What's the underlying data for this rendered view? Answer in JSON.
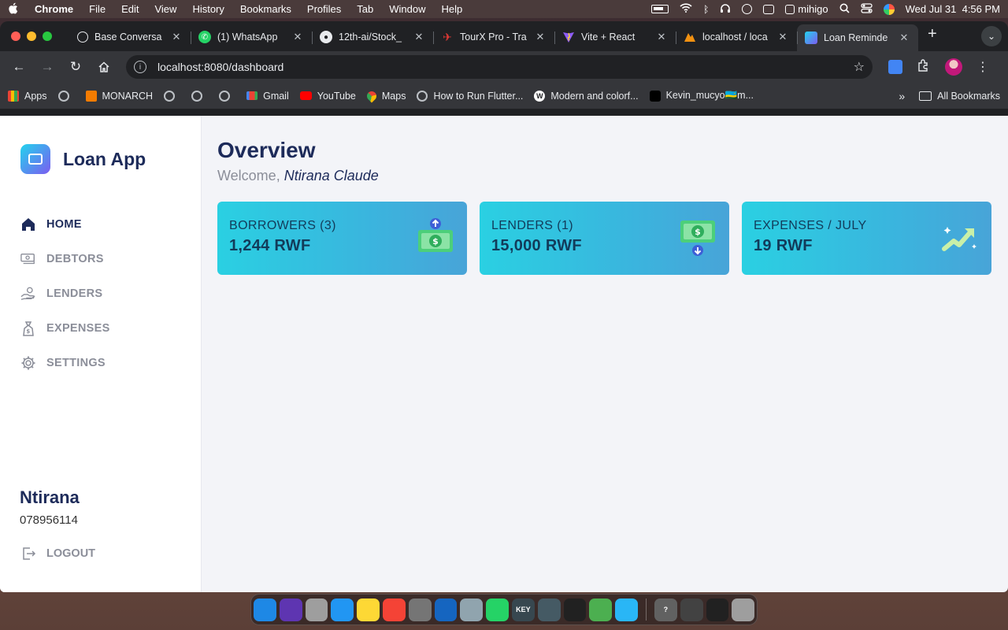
{
  "menubar": {
    "app": "Chrome",
    "items": [
      "File",
      "Edit",
      "View",
      "History",
      "Bookmarks",
      "Profiles",
      "Tab",
      "Window",
      "Help"
    ],
    "user": "mihigo",
    "datetime": "Wed Jul 31  4:56 PM"
  },
  "browser": {
    "tabs": [
      {
        "title": "Base Conversa",
        "favicon": "openai-icon",
        "color": "#202124"
      },
      {
        "title": "(1) WhatsApp",
        "favicon": "whatsapp-icon",
        "color": "#25d366"
      },
      {
        "title": "12th-ai/Stock_",
        "favicon": "github-icon",
        "color": "#202124"
      },
      {
        "title": "TourX Pro - Tra",
        "favicon": "tourx-icon",
        "color": "#e53935"
      },
      {
        "title": "Vite + React",
        "favicon": "vite-icon",
        "color": "#8e5cf7"
      },
      {
        "title": "localhost / loca",
        "favicon": "phpmyadmin-icon",
        "color": "#f29111"
      },
      {
        "title": "Loan Reminde",
        "favicon": "loan-app-icon",
        "color": "#22b3e0",
        "active": true
      }
    ],
    "new_tab_label": "+",
    "url": "localhost:8080/dashboard",
    "bookmarks": [
      {
        "label": "Apps",
        "icon": "apps-grid-icon"
      },
      {
        "label": "",
        "icon": "globe-icon"
      },
      {
        "label": "MONARCH",
        "icon": "monarch-icon"
      },
      {
        "label": "",
        "icon": "globe-icon"
      },
      {
        "label": "",
        "icon": "globe-icon"
      },
      {
        "label": "",
        "icon": "globe-icon"
      },
      {
        "label": "Gmail",
        "icon": "gmail-icon"
      },
      {
        "label": "YouTube",
        "icon": "youtube-icon"
      },
      {
        "label": "Maps",
        "icon": "maps-icon"
      },
      {
        "label": "How to Run Flutter...",
        "icon": "globe-icon"
      },
      {
        "label": "Modern and colorf...",
        "icon": "w-icon"
      },
      {
        "label": "Kevin_mucyo🇷🇼m...",
        "icon": "tiktok-icon"
      }
    ],
    "more_bookmarks": "»",
    "all_bookmarks": "All Bookmarks"
  },
  "app": {
    "brand": "Loan App",
    "nav": [
      {
        "label": "HOME",
        "icon": "home-icon",
        "active": true
      },
      {
        "label": "DEBTORS",
        "icon": "money-icon",
        "active": false
      },
      {
        "label": "LENDERS",
        "icon": "hand-money-icon",
        "active": false
      },
      {
        "label": "EXPENSES",
        "icon": "money-bag-icon",
        "active": false
      },
      {
        "label": "SETTINGS",
        "icon": "gear-icon",
        "active": false
      }
    ],
    "user": {
      "name": "Ntirana",
      "phone": "078956114"
    },
    "logout_label": "LOGOUT",
    "page_title": "Overview",
    "welcome_prefix": "Welcome,",
    "welcome_name": "Ntirana Claude",
    "cards": [
      {
        "label": "BORROWERS (3)",
        "value": "1,244 RWF",
        "icon": "cash-up-icon"
      },
      {
        "label": "LENDERS (1)",
        "value": "15,000 RWF",
        "icon": "cash-down-icon"
      },
      {
        "label": "EXPENSES / JULY",
        "value": "19 RWF",
        "icon": "growth-arrow-icon"
      }
    ]
  },
  "dock": [
    {
      "name": "finder-icon",
      "color": "#1e88e5"
    },
    {
      "name": "siri-icon",
      "color": "#5e35b1"
    },
    {
      "name": "launchpad-icon",
      "color": "#9e9e9e"
    },
    {
      "name": "mail-icon",
      "color": "#2196f3"
    },
    {
      "name": "notes-icon",
      "color": "#fdd835"
    },
    {
      "name": "music-icon",
      "color": "#f44336"
    },
    {
      "name": "system-settings-icon",
      "color": "#757575"
    },
    {
      "name": "vscode-icon",
      "color": "#1565c0"
    },
    {
      "name": "settings-icon",
      "color": "#90a4ae"
    },
    {
      "name": "whatsapp-icon",
      "color": "#25d366"
    },
    {
      "name": "keynote-icon",
      "color": "#37474f",
      "text": "KEY"
    },
    {
      "name": "window-icon",
      "color": "#455a64"
    },
    {
      "name": "figma-icon",
      "color": "#212121"
    },
    {
      "name": "chrome-icon",
      "color": "#4caf50"
    },
    {
      "name": "proxyman-icon",
      "color": "#29b6f6"
    },
    {
      "name": "help-icon",
      "color": "#616161",
      "text": "?"
    },
    {
      "name": "screenshot-icon",
      "color": "#424242"
    },
    {
      "name": "terminal-icon",
      "color": "#212121"
    },
    {
      "name": "trash-icon",
      "color": "#9e9e9e"
    }
  ]
}
